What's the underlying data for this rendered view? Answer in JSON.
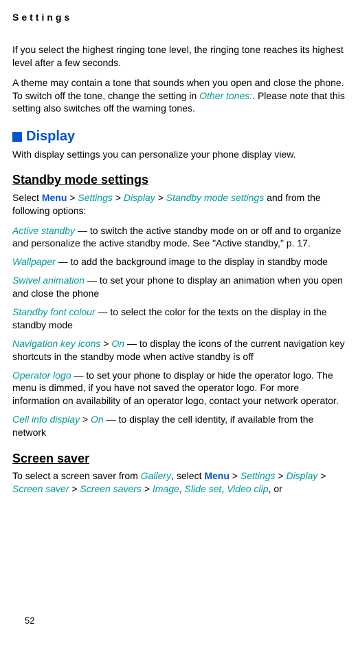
{
  "header": {
    "title": "Settings"
  },
  "intro": {
    "p1": "If you select the highest ringing tone level, the ringing tone reaches its highest level after a few seconds.",
    "p2_a": "A theme may contain a tone that sounds when you open and close the phone. To switch off the tone, change the setting in ",
    "p2_link": "Other tones:",
    "p2_b": ". Please note that this setting also switches off the warning tones."
  },
  "display": {
    "heading": "Display",
    "intro": "With display settings you can personalize your phone display view."
  },
  "standby": {
    "heading": "Standby mode settings",
    "select_a": "Select ",
    "menu": "Menu",
    "gt": " > ",
    "settings": "Settings",
    "display": "Display",
    "standby_link": "Standby mode settings",
    "select_b": " and from the following options:",
    "active_standby": "Active standby",
    "active_standby_text": " — to switch the active standby mode on or off and to organize and personalize the active standby mode. See \"Active standby,\" p. 17.",
    "wallpaper": "Wallpaper",
    "wallpaper_text": " — to add the background image to the display in standby mode",
    "swivel": "Swivel animation",
    "swivel_text": " — to set your phone to display an animation when you open and close the phone",
    "font_colour": "Standby font colour",
    "font_colour_text": " — to select the color for the texts on the display in the standby mode",
    "nav_icons": "Navigation key icons",
    "on": "On",
    "nav_icons_text": " — to display the icons of the current navigation key shortcuts in the standby mode when active standby is off",
    "operator_logo": "Operator logo",
    "operator_logo_text": " — to set your phone to display or hide the operator logo. The menu is dimmed, if you have not saved the operator logo. For more information on availability of an operator logo, contact your network operator.",
    "cell_info": "Cell info display",
    "cell_info_text": " — to display the cell identity, if available from the network"
  },
  "screensaver": {
    "heading": "Screen saver",
    "p_a": "To select a screen saver from ",
    "gallery": "Gallery",
    "p_b": ", select ",
    "menu": "Menu",
    "gt": " > ",
    "settings": "Settings",
    "display": "Display",
    "ss": "Screen saver",
    "sss": "Screen savers",
    "image": "Image",
    "comma": ", ",
    "slideset": "Slide set",
    "videoclip": "Video clip",
    "p_c": ", or"
  },
  "page_num": "52"
}
